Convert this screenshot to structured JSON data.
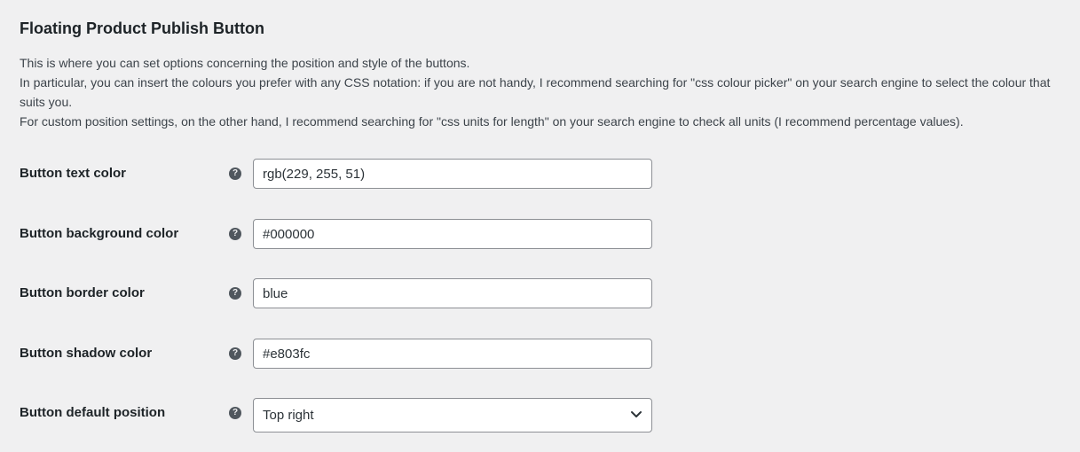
{
  "section": {
    "title": "Floating Product Publish Button",
    "description": [
      "This is where you can set options concerning the position and style of the buttons.",
      "In particular, you can insert the colours you prefer with any CSS notation: if you are not handy, I recommend searching for \"css colour picker\" on your search engine to select the colour that suits you.",
      "For custom position settings, on the other hand, I recommend searching for \"css units for length\" on your search engine to check all units (I recommend percentage values)."
    ]
  },
  "help_icon": "question-circle-icon",
  "fields": {
    "text_color": {
      "label": "Button text color",
      "value": "rgb(229, 255, 51)"
    },
    "background_color": {
      "label": "Button background color",
      "value": "#000000"
    },
    "border_color": {
      "label": "Button border color",
      "value": "blue"
    },
    "shadow_color": {
      "label": "Button shadow color",
      "value": "#e803fc"
    },
    "default_position": {
      "label": "Button default position",
      "selected": "Top right"
    }
  },
  "colors": {
    "page_background": "#f0f0f1",
    "field_border": "#8c8f94",
    "help_icon": "#50575e"
  }
}
